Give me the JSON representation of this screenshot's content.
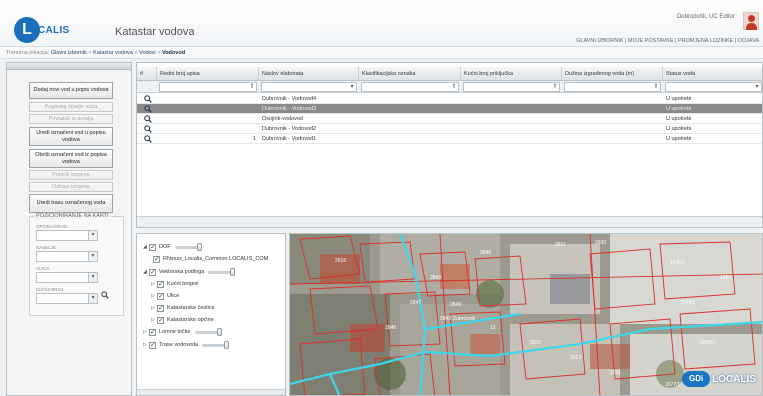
{
  "app": {
    "logo_text": "CALIS",
    "title": "Katastar vodova",
    "user": "Dobrodošli, UC Editor",
    "top_links": "GLAVNI IZBORNIK  |  MOJE POSTAVKE  |  PROMJENA LOZINKE  |  ODJAVA"
  },
  "breadcrumb": {
    "prefix": "Trenutna lokacija:",
    "items": [
      "Glavni izbornik",
      "Katastar vodova",
      "Vodovi"
    ],
    "separator": ">",
    "current": "Vodovod"
  },
  "left_panel": {
    "buttons": [
      {
        "label": "Dodaj novi vod u popis vodova",
        "enabled": true
      },
      {
        "label": "Pogledaj detalje voda",
        "enabled": false
      },
      {
        "label": "Povratak iz detalja",
        "enabled": false
      },
      {
        "label": "Uredi označeni vod u popisu vodova",
        "enabled": true
      },
      {
        "label": "Obriši označeni vod iz popisa vodova",
        "enabled": true
      },
      {
        "label": "Potvrdi izmjene",
        "enabled": false
      },
      {
        "label": "Odbaci izmjene",
        "enabled": false
      },
      {
        "label": "Uredi trasu označenog voda",
        "enabled": true
      }
    ],
    "positioning": {
      "legend": "POZICIONIRANJE NA KARTI",
      "fields": [
        {
          "label": "OPĆINA/GRAD",
          "value": ""
        },
        {
          "label": "NASELJE",
          "value": ""
        },
        {
          "label": "ULICA",
          "value": ""
        },
        {
          "label": "KUĆNI BROJ",
          "value": ""
        }
      ]
    }
  },
  "grid": {
    "columns": [
      "#",
      "Redni broj upisa",
      "Naslov elaborata",
      "Klasifikacijska oznaka",
      "Kućni broj priključka",
      "Dužina izgrađenog voda (m)",
      "Status voda"
    ],
    "rows": [
      {
        "redni_broj": "",
        "naslov": "Dubrovnik - Vodovod4",
        "klasifikacija": "",
        "kucni_broj": "",
        "duzina": "",
        "status": "U upotrebi",
        "selected": false
      },
      {
        "redni_broj": "",
        "naslov": "Dubrovnik - Vodovod3",
        "klasifikacija": "",
        "kucni_broj": "",
        "duzina": "",
        "status": "U upotrebi",
        "selected": true
      },
      {
        "redni_broj": "",
        "naslov": "Osojnik-vodovod",
        "klasifikacija": "",
        "kucni_broj": "",
        "duzina": "",
        "status": "U upotrebi",
        "selected": false
      },
      {
        "redni_broj": "",
        "naslov": "Dubrovnik - Vodovod2",
        "klasifikacija": "",
        "kucni_broj": "",
        "duzina": "",
        "status": "U upotrebi",
        "selected": false
      },
      {
        "redni_broj": "1",
        "naslov": "Dubrovnik - Vodovod1",
        "klasifikacija": "",
        "kucni_broj": "",
        "duzina": "",
        "status": "U upotrebi",
        "selected": false
      }
    ]
  },
  "layers": [
    {
      "label": "DOF",
      "level": 0,
      "expanded": true,
      "checked": true,
      "slider": true
    },
    {
      "label": "RNxxxx_Localis_Common.LOCALIS_COM",
      "level": 1,
      "expanded": null,
      "checked": true,
      "slider": false
    },
    {
      "label": "Vektorska podloga",
      "level": 0,
      "expanded": true,
      "checked": true,
      "slider": true
    },
    {
      "label": "Kućni brojevi",
      "level": 1,
      "expanded": false,
      "checked": true,
      "slider": false
    },
    {
      "label": "Ulice",
      "level": 1,
      "expanded": false,
      "checked": true,
      "slider": false
    },
    {
      "label": "Katastarske čestice",
      "level": 1,
      "expanded": false,
      "checked": true,
      "slider": false
    },
    {
      "label": "Katastarske općine",
      "level": 1,
      "expanded": false,
      "checked": true,
      "slider": false
    },
    {
      "label": "Lomne točke",
      "level": 0,
      "expanded": false,
      "checked": true,
      "slider": true
    },
    {
      "label": "Trase vodovoda",
      "level": 0,
      "expanded": false,
      "checked": true,
      "slider": true
    }
  ],
  "map": {
    "parcel_labels": [
      "2631",
      "2630",
      "2845",
      "2843",
      "2847",
      "2849",
      "2846",
      "12",
      "2849 Dubrovnik",
      "2616",
      "2620",
      "2613",
      "2611",
      "1645/1",
      "1649/1",
      "1655/1",
      "1677/1",
      "1650",
      "1651"
    ],
    "badge": "GDi",
    "brand": "LOCALIS"
  },
  "colors": {
    "accent": "#1a6fb8",
    "selected_row": "#8a8a8a",
    "water_line": "#3fd6e8",
    "parcel_line": "#d8302a"
  }
}
